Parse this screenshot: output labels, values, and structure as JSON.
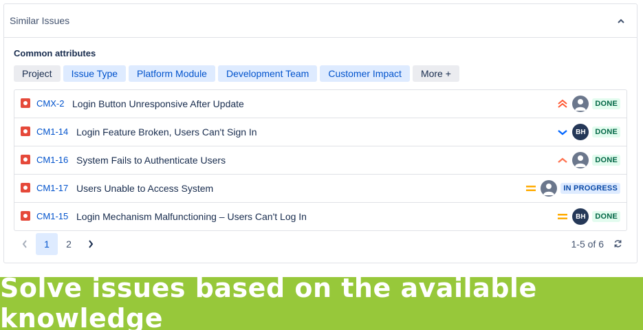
{
  "panel": {
    "title": "Similar Issues",
    "collapse_icon": "chevron-up-icon"
  },
  "attributes": {
    "label": "Common attributes",
    "chips": [
      {
        "label": "Project",
        "selected": false
      },
      {
        "label": "Issue Type",
        "selected": true
      },
      {
        "label": "Platform Module",
        "selected": true
      },
      {
        "label": "Development Team",
        "selected": true
      },
      {
        "label": "Customer Impact",
        "selected": true
      },
      {
        "label": "More +",
        "selected": false
      }
    ]
  },
  "issues": [
    {
      "key": "CMX-2",
      "summary": "Login Button Unresponsive After Update",
      "priority": "highest",
      "assignee": "",
      "status": "DONE"
    },
    {
      "key": "CM1-14",
      "summary": "Login Feature Broken, Users Can't Sign In",
      "priority": "low",
      "assignee": "BH",
      "status": "DONE"
    },
    {
      "key": "CM1-16",
      "summary": "System Fails to Authenticate Users",
      "priority": "high",
      "assignee": "",
      "status": "DONE"
    },
    {
      "key": "CM1-17",
      "summary": "Users Unable to Access System",
      "priority": "medium",
      "assignee": "",
      "status": "IN PROGRESS"
    },
    {
      "key": "CM1-15",
      "summary": "Login Mechanism Malfunctioning – Users Can't Log In",
      "priority": "medium",
      "assignee": "BH",
      "status": "DONE"
    }
  ],
  "pagination": {
    "pages": [
      "1",
      "2"
    ],
    "current": "1",
    "range": "1-5 of 6"
  },
  "banner": {
    "text": "Solve issues based on the available knowledge"
  },
  "colors": {
    "bug": "#e5493a",
    "priority_highest": "#ff5630",
    "priority_high": "#ff7452",
    "priority_medium": "#ffab00",
    "priority_low": "#0065ff",
    "banner_bg": "#97c83a"
  }
}
